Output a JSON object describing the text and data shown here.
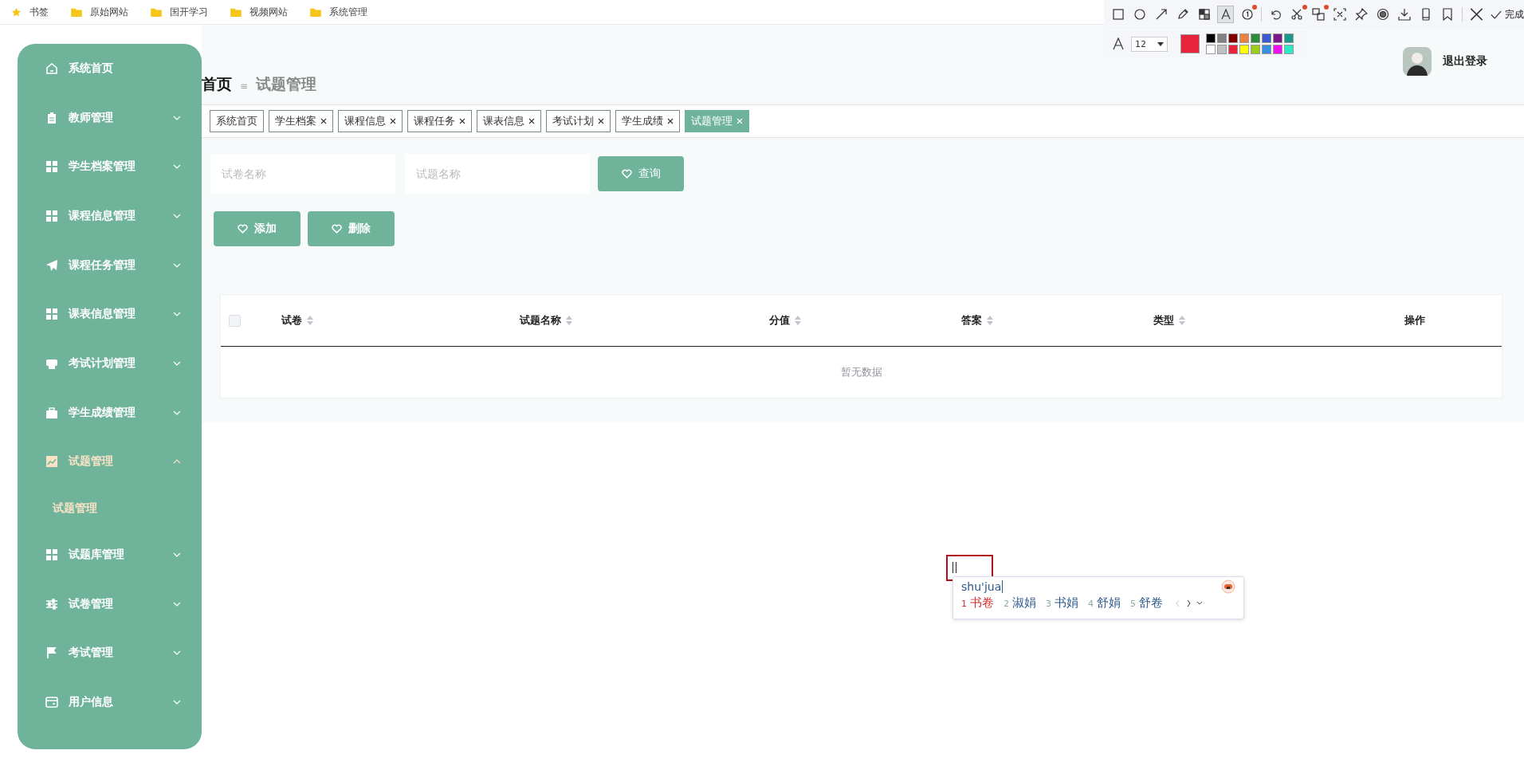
{
  "bookmarks": [
    {
      "label": "书签",
      "kind": "star"
    },
    {
      "label": "原始网站",
      "kind": "folder"
    },
    {
      "label": "国开学习",
      "kind": "folder"
    },
    {
      "label": "视频网站",
      "kind": "folder"
    },
    {
      "label": "系统管理",
      "kind": "folder"
    }
  ],
  "snip_toolbar": {
    "tools": [
      {
        "selected": false,
        "badge": false
      },
      {
        "selected": false,
        "badge": false
      },
      {
        "selected": false,
        "badge": false
      },
      {
        "selected": false,
        "badge": false
      },
      {
        "selected": false,
        "badge": false
      },
      {
        "selected": true,
        "badge": false
      },
      {
        "selected": false,
        "badge": true
      },
      {
        "selected": false,
        "badge": false
      },
      {
        "selected": false,
        "badge": true
      },
      {
        "selected": false,
        "badge": true
      },
      {
        "selected": false,
        "badge": false
      },
      {
        "selected": false,
        "badge": false
      },
      {
        "selected": false,
        "badge": false
      },
      {
        "selected": false,
        "badge": false
      },
      {
        "selected": false,
        "badge": false
      },
      {
        "selected": false,
        "badge": false
      }
    ],
    "done": "完成",
    "font_size": "12",
    "current_swatch": {
      "color": "#e8243c"
    },
    "palette": [
      {
        "color": "#000000"
      },
      {
        "color": "#808080"
      },
      {
        "color": "#800000"
      },
      {
        "color": "#e8823c"
      },
      {
        "color": "#2e8b3a"
      },
      {
        "color": "#3a5ad0"
      },
      {
        "color": "#7a1a8a"
      },
      {
        "color": "#1a9a8a"
      },
      {
        "color": "#ffffff"
      },
      {
        "color": "#c0c0c0"
      },
      {
        "color": "#e8243c"
      },
      {
        "color": "#ffff00"
      },
      {
        "color": "#9acd1a"
      },
      {
        "color": "#3a8ee0"
      },
      {
        "color": "#ee10ee"
      },
      {
        "color": "#2ee8c8"
      }
    ]
  },
  "user": {
    "logout": "退出登录"
  },
  "sidebar": {
    "items": [
      {
        "label": "系统首页",
        "kind": "link",
        "expanded": false,
        "selected": false
      },
      {
        "label": "教师管理",
        "kind": "submenu",
        "expanded": false,
        "selected": false
      },
      {
        "label": "学生档案管理",
        "kind": "submenu",
        "expanded": false,
        "selected": false
      },
      {
        "label": "课程信息管理",
        "kind": "submenu",
        "expanded": false,
        "selected": false
      },
      {
        "label": "课程任务管理",
        "kind": "submenu",
        "expanded": false,
        "selected": false
      },
      {
        "label": "课表信息管理",
        "kind": "submenu",
        "expanded": false,
        "selected": false
      },
      {
        "label": "考试计划管理",
        "kind": "submenu",
        "expanded": false,
        "selected": false
      },
      {
        "label": "学生成绩管理",
        "kind": "submenu",
        "expanded": false,
        "selected": false
      },
      {
        "label": "试题管理",
        "kind": "submenu",
        "expanded": true,
        "selected": true,
        "children": [
          {
            "label": "试题管理",
            "selected": true
          }
        ]
      },
      {
        "label": "试题库管理",
        "kind": "submenu",
        "expanded": false,
        "selected": false
      },
      {
        "label": "试卷管理",
        "kind": "submenu",
        "expanded": false,
        "selected": false
      },
      {
        "label": "考试管理",
        "kind": "submenu",
        "expanded": false,
        "selected": false
      },
      {
        "label": "用户信息",
        "kind": "submenu",
        "expanded": false,
        "selected": false
      }
    ]
  },
  "breadcrumb": {
    "home": "首页",
    "separator": "≡",
    "current": "试题管理"
  },
  "tabs": [
    {
      "label": "系统首页",
      "closable": false,
      "selected": false
    },
    {
      "label": "学生档案",
      "closable": true,
      "selected": false
    },
    {
      "label": "课程信息",
      "closable": true,
      "selected": false
    },
    {
      "label": "课程任务",
      "closable": true,
      "selected": false
    },
    {
      "label": "课表信息",
      "closable": true,
      "selected": false
    },
    {
      "label": "考试计划",
      "closable": true,
      "selected": false
    },
    {
      "label": "学生成绩",
      "closable": true,
      "selected": false
    },
    {
      "label": "试题管理",
      "closable": true,
      "selected": true
    }
  ],
  "search": {
    "fields": [
      {
        "placeholder": "试卷名称"
      },
      {
        "placeholder": "试题名称"
      }
    ],
    "button": "查询"
  },
  "actions": [
    "添加",
    "删除"
  ],
  "table": {
    "select_all_checked": false,
    "columns": [
      {
        "label": "试卷",
        "sortable": true
      },
      {
        "label": "试题名称",
        "sortable": true
      },
      {
        "label": "分值",
        "sortable": true
      },
      {
        "label": "答案",
        "sortable": true
      },
      {
        "label": "类型",
        "sortable": true
      },
      {
        "label": "操作",
        "sortable": false
      }
    ],
    "empty_text": "暂无数据"
  },
  "ime": {
    "composition": "shu'jua",
    "candidates": [
      {
        "number": "1",
        "text": "书卷",
        "selected": true
      },
      {
        "number": "2",
        "text": "淑娟",
        "selected": false
      },
      {
        "number": "3",
        "text": "书娟",
        "selected": false
      },
      {
        "number": "4",
        "text": "舒娟",
        "selected": false
      },
      {
        "number": "5",
        "text": "舒卷",
        "selected": false
      }
    ]
  }
}
